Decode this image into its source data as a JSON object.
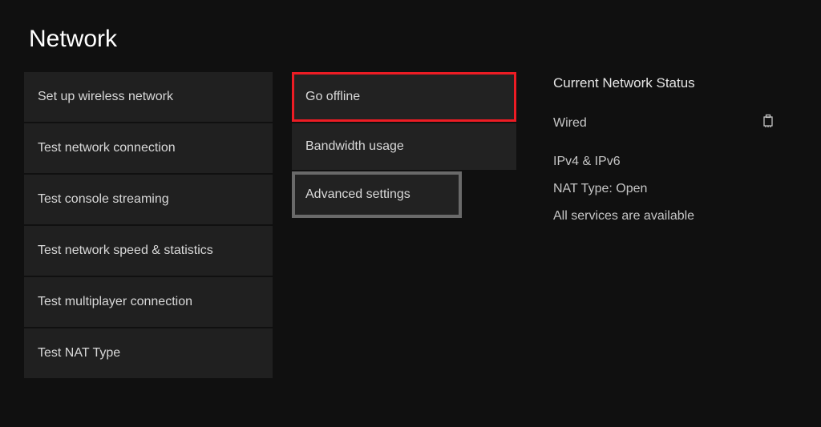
{
  "title": "Network",
  "left_column": {
    "items": [
      "Set up wireless network",
      "Test network connection",
      "Test console streaming",
      "Test network speed & statistics",
      "Test multiplayer connection",
      "Test NAT Type"
    ]
  },
  "middle_column": {
    "items": [
      "Go offline",
      "Bandwidth usage",
      "Advanced settings"
    ]
  },
  "status": {
    "heading": "Current Network Status",
    "connection": "Wired",
    "ip": "IPv4 & IPv6",
    "nat": "NAT Type: Open",
    "services": "All services are available"
  }
}
